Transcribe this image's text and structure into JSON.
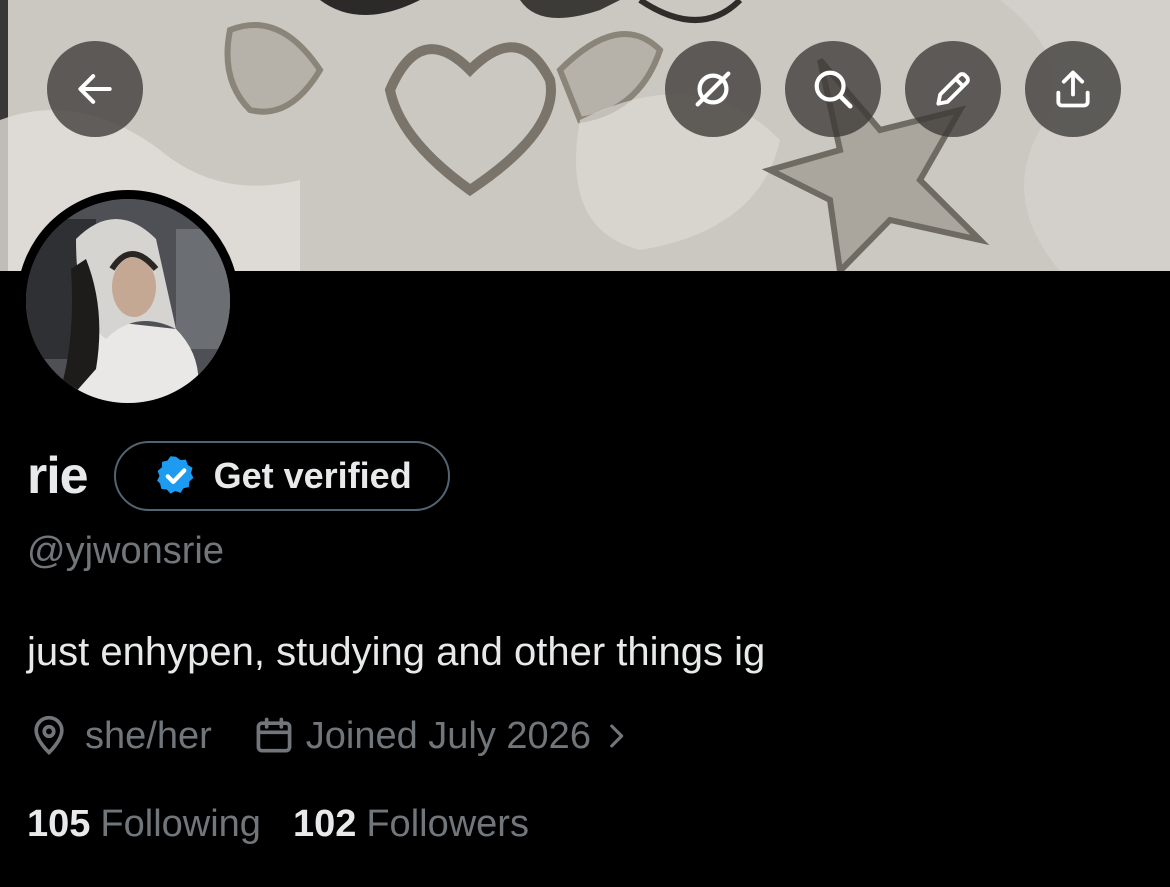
{
  "header": {
    "buttons": [
      {
        "name": "back-button",
        "icon": "arrow-left-icon"
      },
      {
        "name": "grok-button",
        "icon": "grok-slash-circle-icon"
      },
      {
        "name": "search-button",
        "icon": "search-icon"
      },
      {
        "name": "edit-button",
        "icon": "pencil-icon"
      },
      {
        "name": "share-button",
        "icon": "share-upload-icon"
      }
    ]
  },
  "profile": {
    "display_name": "rie",
    "verify_button_label": "Get verified",
    "handle": "@yjwonsrie",
    "bio": "just enhypen, studying and other things ig",
    "pronouns": "she/her",
    "joined": "Joined July 2026",
    "following_count": "105",
    "following_label": "Following",
    "followers_count": "102",
    "followers_label": "Followers"
  },
  "colors": {
    "background": "#000000",
    "primary_text": "#e7e9ea",
    "secondary_text": "#71767b",
    "verified_badge": "#1d9bf0",
    "pill_border": "#536471"
  }
}
